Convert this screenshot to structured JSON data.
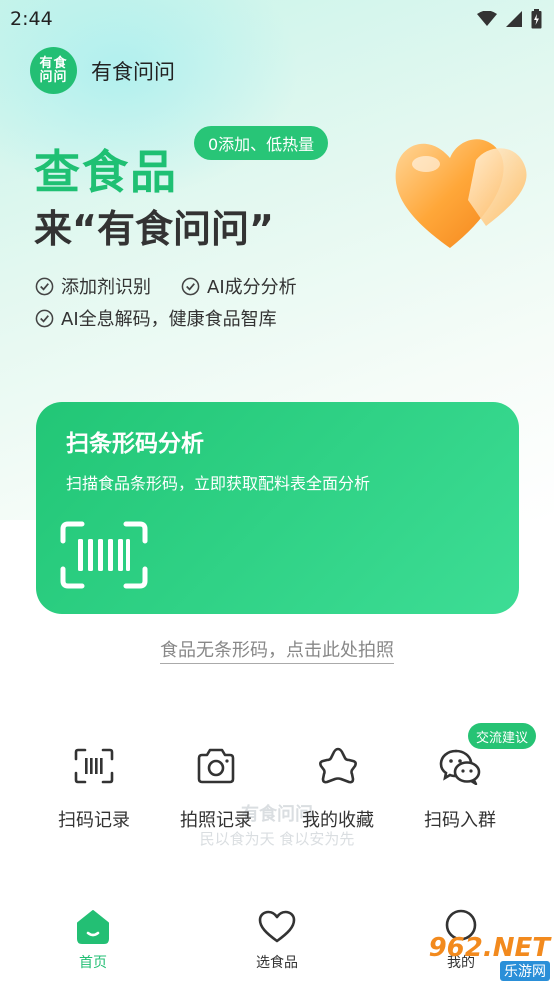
{
  "status_bar": {
    "time": "2:44"
  },
  "app": {
    "logo_text": "有食问问",
    "name": "有食问问"
  },
  "hero": {
    "title_line1": "查食品",
    "title_line2": "来“有食问问”",
    "badge": "0添加、低热量",
    "features": [
      "添加剂识别",
      "AI成分分析",
      "AI全息解码，健康食品智库"
    ]
  },
  "scan_card": {
    "title": "扫条形码分析",
    "subtitle": "扫描食品条形码，立即获取配料表全面分析"
  },
  "photo_link": "食品无条形码，点击此处拍照",
  "quick_actions": [
    {
      "label": "扫码记录",
      "icon": "barcode-scan-icon"
    },
    {
      "label": "拍照记录",
      "icon": "camera-icon"
    },
    {
      "label": "我的收藏",
      "icon": "star-icon"
    },
    {
      "label": "扫码入群",
      "icon": "wechat-icon"
    }
  ],
  "exchange_badge": "交流建议",
  "watermark": {
    "title": "有食问问",
    "subtitle": "民以食为天 食以安为先"
  },
  "bottom_nav": [
    {
      "label": "首页",
      "active": true
    },
    {
      "label": "选食品",
      "active": false
    },
    {
      "label": "我的",
      "active": false
    }
  ],
  "site_logo": {
    "big": "962.NET",
    "small": "乐游网"
  },
  "colors": {
    "brand": "#23bf74",
    "text": "#333333",
    "muted": "#888888"
  }
}
